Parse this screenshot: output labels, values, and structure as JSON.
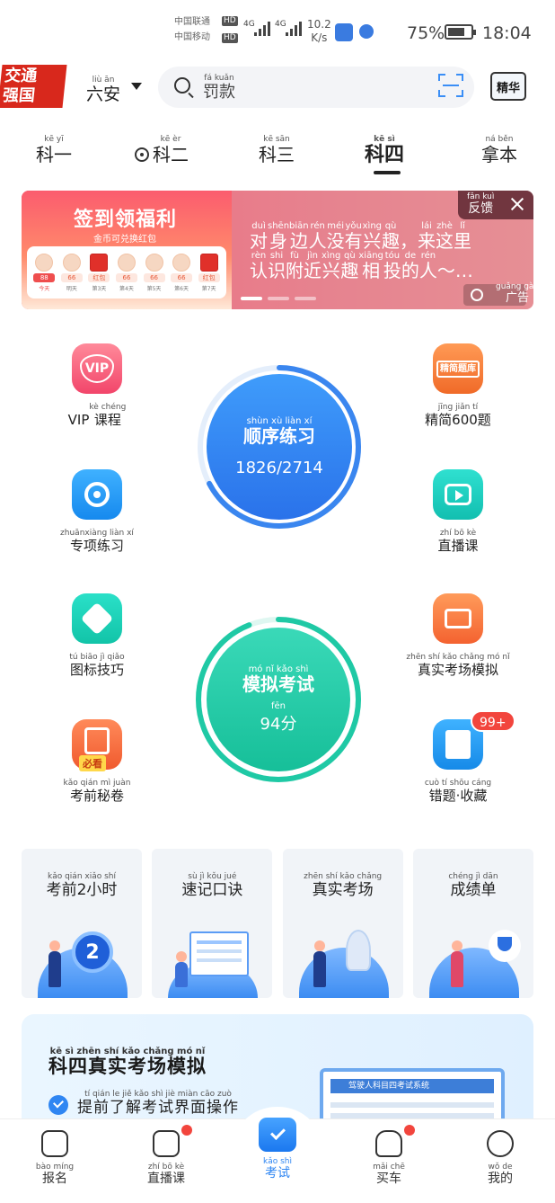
{
  "status_bar": {
    "carrier1": "中国联通",
    "carrier2": "中国移动",
    "hd": "HD",
    "net": "4G",
    "speed_value": "10.2",
    "speed_unit": "K/s",
    "battery_pct": "75%",
    "battery_level": 0.75,
    "time": "18:04"
  },
  "header": {
    "logo_line1": "交通",
    "logo_line2": "强国",
    "city": {
      "hz": "六安",
      "py": "liù ān"
    },
    "search_placeholder": {
      "hz": "罚款",
      "py": "fá kuǎn"
    },
    "tv_label": "精华"
  },
  "subject_tabs": [
    {
      "hz": "科一",
      "py": "kē yī"
    },
    {
      "hz": "科二",
      "py": "kē èr"
    },
    {
      "hz": "科三",
      "py": "kē sān"
    },
    {
      "hz": "科四",
      "py": "kē sì"
    },
    {
      "hz": "拿本",
      "py": "ná běn"
    }
  ],
  "banner": {
    "checkin_title": "签到领福利",
    "checkin_sub": "金币可兑换红包",
    "days": [
      {
        "pts": "88",
        "label": "今天"
      },
      {
        "pts": "66",
        "label": "明天"
      },
      {
        "pts": "红包",
        "label": "第3天"
      },
      {
        "pts": "66",
        "label": "第4天"
      },
      {
        "pts": "66",
        "label": "第5天"
      },
      {
        "pts": "66",
        "label": "第6天"
      },
      {
        "pts": "红包",
        "label": "第7天"
      }
    ],
    "text_line1": [
      {
        "hz": "对",
        "py": "duì"
      },
      {
        "hz": "身",
        "py": "shēn"
      },
      {
        "hz": "边",
        "py": "biān"
      },
      {
        "hz": "人",
        "py": "rén"
      },
      {
        "hz": "没",
        "py": "méi"
      },
      {
        "hz": "有",
        "py": "yǒu"
      },
      {
        "hz": "兴",
        "py": "xìng"
      },
      {
        "hz": "趣",
        "py": "qù"
      },
      {
        "hz": "，",
        "py": ""
      },
      {
        "hz": "来",
        "py": "lái"
      },
      {
        "hz": "这",
        "py": "zhè"
      },
      {
        "hz": "里",
        "py": "lǐ"
      }
    ],
    "text_line2": [
      {
        "hz": "认",
        "py": "rèn"
      },
      {
        "hz": "识",
        "py": "shi"
      },
      {
        "hz": "附",
        "py": "fù"
      },
      {
        "hz": "近",
        "py": "jìn"
      },
      {
        "hz": "兴",
        "py": "xìng"
      },
      {
        "hz": "趣",
        "py": "qù"
      },
      {
        "hz": "相",
        "py": "xiāng"
      },
      {
        "hz": "投",
        "py": "tóu"
      },
      {
        "hz": "的",
        "py": "de"
      },
      {
        "hz": "人",
        "py": "rén"
      },
      {
        "hz": "～…",
        "py": ""
      }
    ],
    "feedback": {
      "hz": "反馈",
      "py": "fǎn kuì"
    },
    "ad": {
      "hz": "广告",
      "py": "guǎng gào"
    }
  },
  "functions": {
    "vip": {
      "hz": "VIP课程",
      "py": "kè chéng",
      "icon_text": "VIP"
    },
    "jingjian": {
      "hz": "精简600题",
      "py": "jīng jiǎn tí",
      "icon_text": "精简题库"
    },
    "zhuanxiang": {
      "hz": "专项练习",
      "py": "zhuānxiàng liàn xí"
    },
    "zhibo": {
      "hz": "直播课",
      "py": "zhí bō kè"
    },
    "tubiao": {
      "hz": "图标技巧",
      "py": "tú biāo jì qiǎo"
    },
    "zhenshi": {
      "hz": "真实考场模拟",
      "py": "zhēn shí kǎo chǎng mó nǐ"
    },
    "miju": {
      "hz": "考前秘卷",
      "py": "kǎo qián mì juàn",
      "icon_text": "必看"
    },
    "cuoti": {
      "hz": "错题·收藏",
      "py": "cuò tí shōu cáng",
      "badge": "99+"
    }
  },
  "practice": {
    "title": {
      "hz": "顺序练习",
      "py": "shùn xù liàn xí"
    },
    "progress": "1826/2714",
    "done": 1826,
    "total": 2714
  },
  "mock_exam": {
    "title": {
      "hz": "模拟考试",
      "py": "mó nǐ kǎo shì"
    },
    "score": "94分",
    "score_py": "fēn",
    "score_value": 94
  },
  "cards": [
    {
      "hz": "考前2小时",
      "py": "kǎo qián xiǎo shí"
    },
    {
      "hz": "速记口诀",
      "py": "sù jì kǒu jué"
    },
    {
      "hz": "真实考场",
      "py": "zhēn shí kǎo chǎng"
    },
    {
      "hz": "成绩单",
      "py": "chéng jì dān"
    }
  ],
  "promo": {
    "title": {
      "hz": "科四真实考场模拟",
      "py": "kē sì zhēn shí kǎo chǎng mó nǐ"
    },
    "subtitle": {
      "hz": "提前了解考试界面操作",
      "py": "tí qián le jiě kǎo shì jiè miàn cāo zuò"
    },
    "screen_title": "驾驶人科目四考试系统"
  },
  "bottom_nav": [
    {
      "hz": "报名",
      "py": "bào míng"
    },
    {
      "hz": "直播课",
      "py": "zhí bō kè"
    },
    {
      "hz": "考试",
      "py": "kǎo shì"
    },
    {
      "hz": "买车",
      "py": "mǎi chē"
    },
    {
      "hz": "我的",
      "py": "wǒ de"
    }
  ]
}
